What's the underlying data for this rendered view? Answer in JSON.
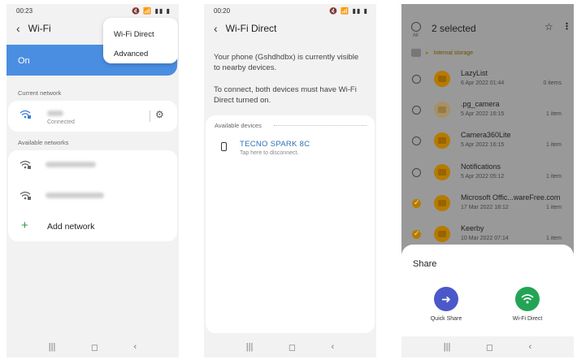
{
  "phone1": {
    "status": {
      "time": "00:23",
      "icons": "🔇 📶 ▮▮ ▮"
    },
    "title": "Wi-Fi",
    "toggle_label": "On",
    "menu": [
      "Wi-Fi Direct",
      "Advanced"
    ],
    "current_network_label": "Current network",
    "connected_label": "Connected",
    "available_networks_label": "Available networks",
    "add_network_label": "Add network"
  },
  "phone2": {
    "status": {
      "time": "00:20",
      "icons": "🔇 📶 ▮▮ ▮"
    },
    "title": "Wi-Fi Direct",
    "visible_text": "Your phone (Gshdhdbx) is currently visible to nearby devices.",
    "connect_text": "To connect, both devices must have Wi-Fi Direct turned on.",
    "available_devices_label": "Available devices",
    "device_name": "TECNO SPARK 8C",
    "device_sub": "Tap here to disconnect."
  },
  "phone3": {
    "all_label": "All",
    "selected_label": "2 selected",
    "path_label": "Internal storage",
    "files": [
      {
        "name": "LazyList",
        "date": "6 Apr 2022 01:44",
        "count": "0 items",
        "selected": false,
        "faded": false
      },
      {
        "name": ".pg_camera",
        "date": "5 Apr 2022 16:15",
        "count": "1 item",
        "selected": false,
        "faded": true
      },
      {
        "name": "Camera360Lite",
        "date": "5 Apr 2022 16:15",
        "count": "1 item",
        "selected": false,
        "faded": false
      },
      {
        "name": "Notifications",
        "date": "5 Apr 2022 05:12",
        "count": "1 item",
        "selected": false,
        "faded": false
      },
      {
        "name": "Microsoft Offic...wareFree.com",
        "date": "17 Mar 2022 18:12",
        "count": "1 item",
        "selected": true,
        "faded": false
      },
      {
        "name": "Keerby",
        "date": "10 Mar 2022 07:14",
        "count": "1 item",
        "selected": true,
        "faded": false
      }
    ],
    "share_title": "Share",
    "share_apps": [
      {
        "label": "Quick Share",
        "color": "#4b58c8",
        "icon": "quick-share-icon"
      },
      {
        "label": "Wi-Fi Direct",
        "color": "#23a455",
        "icon": "wifi-direct-icon"
      }
    ]
  },
  "navbar_icons": [
    "recent-apps-icon",
    "home-icon",
    "back-icon"
  ]
}
